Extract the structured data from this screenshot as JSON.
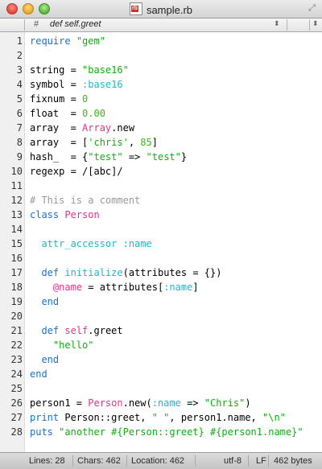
{
  "window": {
    "title": "sample.rb",
    "icon_text": "rb"
  },
  "symbol_bar": {
    "hash": "#",
    "current_symbol": "def self.greet"
  },
  "colors": {
    "keyword": "#1a72cf",
    "string": "#0fb00f",
    "symbol": "#1fb7c7",
    "constant": "#e8328c",
    "comment": "#9a9a9a",
    "ivar": "#e8328c",
    "number": "#3cb815",
    "plain": "#000000"
  },
  "code_lines": [
    [
      [
        "kw",
        "require"
      ],
      [
        "p",
        " "
      ],
      [
        "str",
        "\"gem\""
      ]
    ],
    [],
    [
      [
        "p",
        "string = "
      ],
      [
        "str",
        "\"base16\""
      ]
    ],
    [
      [
        "p",
        "symbol = "
      ],
      [
        "sym",
        ":base16"
      ]
    ],
    [
      [
        "p",
        "fixnum = "
      ],
      [
        "num",
        "0"
      ]
    ],
    [
      [
        "p",
        "float  = "
      ],
      [
        "num",
        "0.00"
      ]
    ],
    [
      [
        "p",
        "array  = "
      ],
      [
        "const",
        "Array"
      ],
      [
        "p",
        ".new"
      ]
    ],
    [
      [
        "p",
        "array  = ["
      ],
      [
        "str",
        "'chris'"
      ],
      [
        "p",
        ", "
      ],
      [
        "num",
        "85"
      ],
      [
        "p",
        "]"
      ]
    ],
    [
      [
        "p",
        "hash_  = {"
      ],
      [
        "str",
        "\"test\""
      ],
      [
        "p",
        " => "
      ],
      [
        "str",
        "\"test\""
      ],
      [
        "p",
        "}"
      ]
    ],
    [
      [
        "p",
        "regexp = /[abc]/"
      ]
    ],
    [],
    [
      [
        "cmt",
        "# This is a comment"
      ]
    ],
    [
      [
        "kw",
        "class"
      ],
      [
        "p",
        " "
      ],
      [
        "const",
        "Person"
      ]
    ],
    [],
    [
      [
        "p",
        "  "
      ],
      [
        "sym",
        "attr_accessor :name"
      ]
    ],
    [],
    [
      [
        "p",
        "  "
      ],
      [
        "kw",
        "def"
      ],
      [
        "p",
        " "
      ],
      [
        "sym",
        "initialize"
      ],
      [
        "p",
        "(attributes = {})"
      ]
    ],
    [
      [
        "p",
        "    "
      ],
      [
        "ivar",
        "@name"
      ],
      [
        "p",
        " = attributes["
      ],
      [
        "sym",
        ":name"
      ],
      [
        "p",
        "]"
      ]
    ],
    [
      [
        "p",
        "  "
      ],
      [
        "kw",
        "end"
      ]
    ],
    [],
    [
      [
        "p",
        "  "
      ],
      [
        "kw",
        "def"
      ],
      [
        "p",
        " "
      ],
      [
        "const",
        "self"
      ],
      [
        "p",
        ".greet"
      ]
    ],
    [
      [
        "p",
        "    "
      ],
      [
        "str",
        "\"hello\""
      ]
    ],
    [
      [
        "p",
        "  "
      ],
      [
        "kw",
        "end"
      ]
    ],
    [
      [
        "kw",
        "end"
      ]
    ],
    [],
    [
      [
        "p",
        "person1 = "
      ],
      [
        "const",
        "Person"
      ],
      [
        "p",
        ".new("
      ],
      [
        "sym",
        ":name"
      ],
      [
        "p",
        " => "
      ],
      [
        "str",
        "\"Chris\""
      ],
      [
        "p",
        ")"
      ]
    ],
    [
      [
        "kw",
        "print"
      ],
      [
        "p",
        " Person::greet, "
      ],
      [
        "str",
        "\" \""
      ],
      [
        "p",
        ", person1.name, "
      ],
      [
        "str",
        "\"\\n\""
      ]
    ],
    [
      [
        "kw",
        "puts"
      ],
      [
        "p",
        " "
      ],
      [
        "str",
        "\"another #{Person::greet} #{person1.name}\""
      ]
    ]
  ],
  "status_bar": {
    "lines": "Lines: 28",
    "chars": "Chars: 462",
    "location": "Location: 462",
    "encoding": "utf-8",
    "line_ending": "LF",
    "size": "462 bytes"
  }
}
